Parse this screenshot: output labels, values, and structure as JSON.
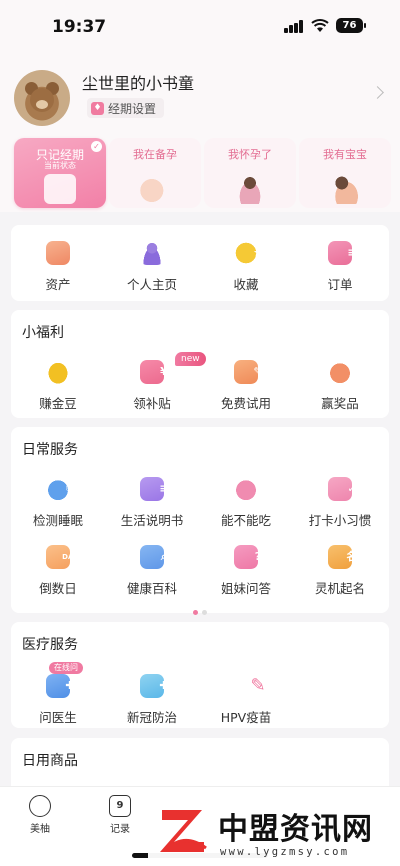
{
  "status_bar": {
    "time": "19:37",
    "battery": "76"
  },
  "profile": {
    "username": "尘世里的小书童",
    "period_settings_label": "经期设置"
  },
  "modes": [
    {
      "label": "只记经期",
      "sub": "当前状态",
      "active": true
    },
    {
      "label": "我在备孕",
      "active": false
    },
    {
      "label": "我怀孕了",
      "active": false
    },
    {
      "label": "我有宝宝",
      "active": false
    }
  ],
  "quick_links": [
    {
      "label": "资产",
      "icon": "wallet-icon"
    },
    {
      "label": "个人主页",
      "icon": "person-icon"
    },
    {
      "label": "收藏",
      "icon": "star-icon"
    },
    {
      "label": "订单",
      "icon": "order-icon"
    }
  ],
  "welfare": {
    "title": "小福利",
    "new_badge": "new",
    "items": [
      {
        "label": "赚金豆",
        "icon": "gold-bean-icon"
      },
      {
        "label": "领补贴",
        "icon": "yen-icon"
      },
      {
        "label": "免费试用",
        "icon": "free-trial-icon"
      },
      {
        "label": "赢奖品",
        "icon": "prize-icon"
      }
    ]
  },
  "daily": {
    "title": "日常服务",
    "items": [
      {
        "label": "检测睡眠",
        "icon": "sleep-icon"
      },
      {
        "label": "生活说明书",
        "icon": "manual-icon"
      },
      {
        "label": "能不能吃",
        "icon": "can-eat-icon"
      },
      {
        "label": "打卡小习惯",
        "icon": "habit-checkin-icon"
      },
      {
        "label": "倒数日",
        "icon": "countdown-icon",
        "glyph": "DAY"
      },
      {
        "label": "健康百科",
        "icon": "health-wiki-icon"
      },
      {
        "label": "姐妹问答",
        "icon": "qa-icon",
        "glyph": "?"
      },
      {
        "label": "灵机起名",
        "icon": "naming-icon"
      }
    ]
  },
  "medical": {
    "title": "医疗服务",
    "online_badge": "在线问",
    "items": [
      {
        "label": "问医生",
        "icon": "doctor-icon"
      },
      {
        "label": "新冠防治",
        "icon": "covid-shield-icon"
      },
      {
        "label": "HPV疫苗",
        "icon": "vaccine-icon"
      }
    ]
  },
  "goods": {
    "title": "日用商品"
  },
  "tabbar": [
    {
      "label": "美柚",
      "icon": "home-icon"
    },
    {
      "label": "记录",
      "icon": "calendar-icon",
      "glyph": "9"
    }
  ],
  "watermark": {
    "title": "中盟资讯网",
    "url": "www.lygzmsy.com"
  },
  "colors": {
    "accent": "#f07aa1",
    "background": "#f5f4f6"
  }
}
